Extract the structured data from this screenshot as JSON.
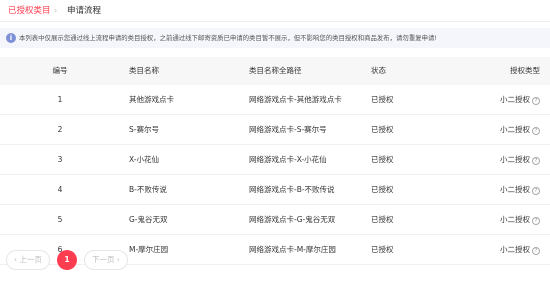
{
  "tabs": {
    "active": "已授权类目",
    "separator": "›",
    "second": "申请流程"
  },
  "notice": {
    "icon": "info-icon",
    "icon_glyph": "i",
    "text": "本列表中仅展示您通过线上流程申请的类目授权，之前通过线下邮寄资质已申请的类目暂不展示，但不影响您的类目授权和商品发布，请勿重复申请!"
  },
  "table": {
    "headers": {
      "id": "编号",
      "name": "类目名称",
      "path": "类目名称全路径",
      "status": "状态",
      "type": "授权类型"
    },
    "rows": [
      {
        "id": "1",
        "name": "其他游戏点卡",
        "path": "网络游戏点卡-其他游戏点卡",
        "status": "已授权",
        "type": "小二授权"
      },
      {
        "id": "2",
        "name": "S-赛尔号",
        "path": "网络游戏点卡-S-赛尔号",
        "status": "已授权",
        "type": "小二授权"
      },
      {
        "id": "3",
        "name": "X-小花仙",
        "path": "网络游戏点卡-X-小花仙",
        "status": "已授权",
        "type": "小二授权"
      },
      {
        "id": "4",
        "name": "B-不败传说",
        "path": "网络游戏点卡-B-不败传说",
        "status": "已授权",
        "type": "小二授权"
      },
      {
        "id": "5",
        "name": "G-鬼谷无双",
        "path": "网络游戏点卡-G-鬼谷无双",
        "status": "已授权",
        "type": "小二授权"
      },
      {
        "id": "6",
        "name": "M-摩尔庄园",
        "path": "网络游戏点卡-M-摩尔庄园",
        "status": "已授权",
        "type": "小二授权"
      }
    ],
    "help_icon": "question-circle-icon",
    "help_glyph": "?"
  },
  "pagination": {
    "prev": "‹ 上一页",
    "current": "1",
    "next": "下一页 ›"
  },
  "colors": {
    "accent": "#ff3d50",
    "header_bg": "#f7f7f7",
    "notice_bg": "#f5f6fb",
    "info_icon": "#7d8fd6"
  }
}
